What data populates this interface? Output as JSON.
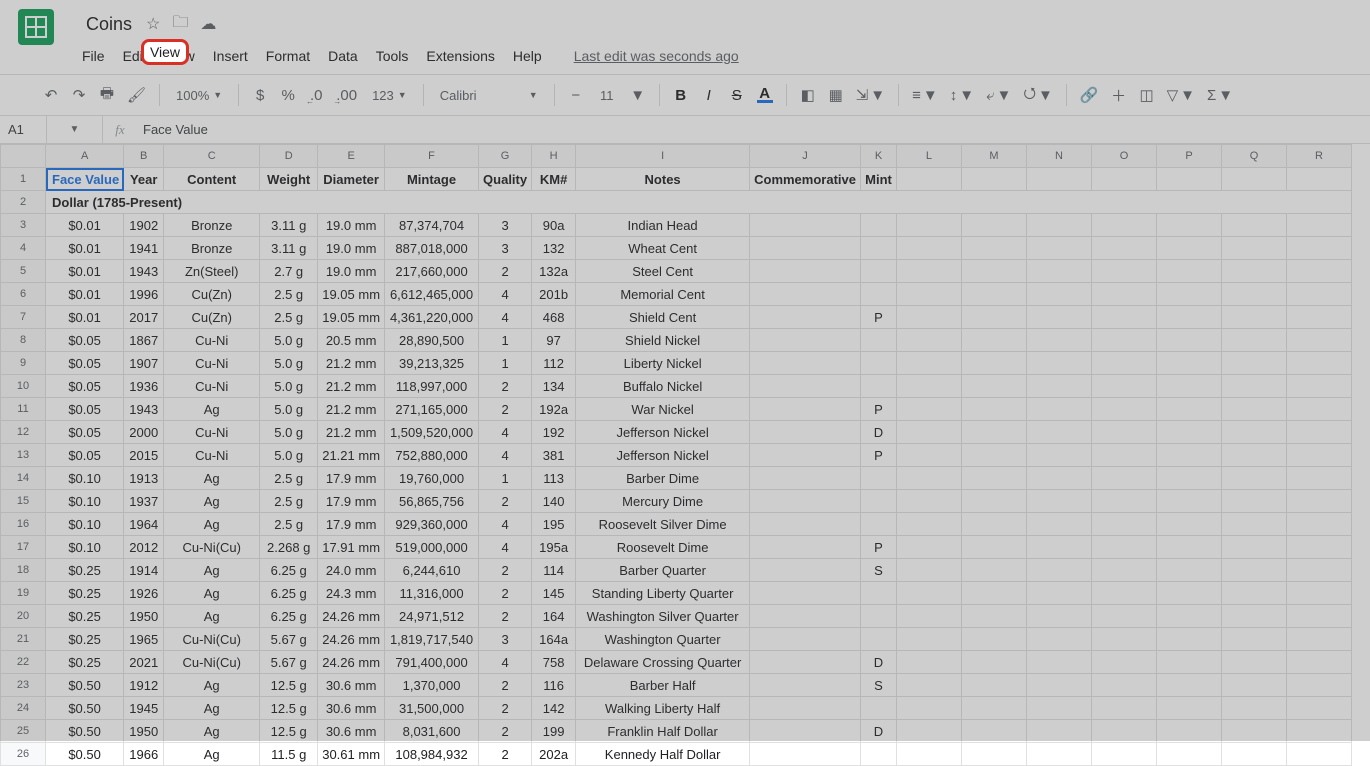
{
  "doc": {
    "title": "Coins"
  },
  "menubar": {
    "file": "File",
    "edit": "Edit",
    "view": "View",
    "insert": "Insert",
    "format": "Format",
    "data": "Data",
    "tools": "Tools",
    "extensions": "Extensions",
    "help": "Help",
    "last_edit": "Last edit was seconds ago"
  },
  "toolbar": {
    "zoom": "100%",
    "font": "Calibri",
    "fontsize": "11",
    "currency": "$",
    "percent": "%",
    "decr": ".0",
    "incr": ".00",
    "numfmt": "123",
    "bold": "B",
    "italic": "I",
    "strike": "S",
    "textA": "A"
  },
  "namebox": {
    "ref": "A1",
    "fx": "fx",
    "formula": "Face Value"
  },
  "col_letters": [
    "A",
    "B",
    "C",
    "D",
    "E",
    "F",
    "G",
    "H",
    "I",
    "J",
    "K",
    "L",
    "M",
    "N",
    "O",
    "P",
    "Q",
    "R"
  ],
  "headers": [
    "Face Value",
    "Year",
    "Content",
    "Weight",
    "Diameter",
    "Mintage",
    "Quality",
    "KM#",
    "Notes",
    "Commemorative",
    "Mint"
  ],
  "section": "Dollar (1785-Present)",
  "rows": [
    {
      "fv": "$0.01",
      "yr": "1902",
      "ct": "Bronze",
      "wt": "3.11 g",
      "dm": "19.0 mm",
      "mt": "87,374,704",
      "q": "3",
      "km": "90a",
      "nt": "Indian Head",
      "cm": "",
      "mn": ""
    },
    {
      "fv": "$0.01",
      "yr": "1941",
      "ct": "Bronze",
      "wt": "3.11 g",
      "dm": "19.0 mm",
      "mt": "887,018,000",
      "q": "3",
      "km": "132",
      "nt": "Wheat Cent",
      "cm": "",
      "mn": ""
    },
    {
      "fv": "$0.01",
      "yr": "1943",
      "ct": "Zn(Steel)",
      "wt": "2.7 g",
      "dm": "19.0 mm",
      "mt": "217,660,000",
      "q": "2",
      "km": "132a",
      "nt": "Steel Cent",
      "cm": "",
      "mn": ""
    },
    {
      "fv": "$0.01",
      "yr": "1996",
      "ct": "Cu(Zn)",
      "wt": "2.5 g",
      "dm": "19.05 mm",
      "mt": "6,612,465,000",
      "q": "4",
      "km": "201b",
      "nt": "Memorial Cent",
      "cm": "",
      "mn": ""
    },
    {
      "fv": "$0.01",
      "yr": "2017",
      "ct": "Cu(Zn)",
      "wt": "2.5 g",
      "dm": "19.05 mm",
      "mt": "4,361,220,000",
      "q": "4",
      "km": "468",
      "nt": "Shield Cent",
      "cm": "",
      "mn": "P"
    },
    {
      "fv": "$0.05",
      "yr": "1867",
      "ct": "Cu-Ni",
      "wt": "5.0 g",
      "dm": "20.5 mm",
      "mt": "28,890,500",
      "q": "1",
      "km": "97",
      "nt": "Shield Nickel",
      "cm": "",
      "mn": ""
    },
    {
      "fv": "$0.05",
      "yr": "1907",
      "ct": "Cu-Ni",
      "wt": "5.0 g",
      "dm": "21.2 mm",
      "mt": "39,213,325",
      "q": "1",
      "km": "112",
      "nt": "Liberty Nickel",
      "cm": "",
      "mn": ""
    },
    {
      "fv": "$0.05",
      "yr": "1936",
      "ct": "Cu-Ni",
      "wt": "5.0 g",
      "dm": "21.2 mm",
      "mt": "118,997,000",
      "q": "2",
      "km": "134",
      "nt": "Buffalo Nickel",
      "cm": "",
      "mn": ""
    },
    {
      "fv": "$0.05",
      "yr": "1943",
      "ct": "Ag",
      "wt": "5.0 g",
      "dm": "21.2 mm",
      "mt": "271,165,000",
      "q": "2",
      "km": "192a",
      "nt": "War Nickel",
      "cm": "",
      "mn": "P"
    },
    {
      "fv": "$0.05",
      "yr": "2000",
      "ct": "Cu-Ni",
      "wt": "5.0 g",
      "dm": "21.2 mm",
      "mt": "1,509,520,000",
      "q": "4",
      "km": "192",
      "nt": "Jefferson Nickel",
      "cm": "",
      "mn": "D"
    },
    {
      "fv": "$0.05",
      "yr": "2015",
      "ct": "Cu-Ni",
      "wt": "5.0 g",
      "dm": "21.21 mm",
      "mt": "752,880,000",
      "q": "4",
      "km": "381",
      "nt": "Jefferson Nickel",
      "cm": "",
      "mn": "P"
    },
    {
      "fv": "$0.10",
      "yr": "1913",
      "ct": "Ag",
      "wt": "2.5 g",
      "dm": "17.9 mm",
      "mt": "19,760,000",
      "q": "1",
      "km": "113",
      "nt": "Barber Dime",
      "cm": "",
      "mn": ""
    },
    {
      "fv": "$0.10",
      "yr": "1937",
      "ct": "Ag",
      "wt": "2.5 g",
      "dm": "17.9 mm",
      "mt": "56,865,756",
      "q": "2",
      "km": "140",
      "nt": "Mercury Dime",
      "cm": "",
      "mn": ""
    },
    {
      "fv": "$0.10",
      "yr": "1964",
      "ct": "Ag",
      "wt": "2.5 g",
      "dm": "17.9 mm",
      "mt": "929,360,000",
      "q": "4",
      "km": "195",
      "nt": "Roosevelt Silver Dime",
      "cm": "",
      "mn": ""
    },
    {
      "fv": "$0.10",
      "yr": "2012",
      "ct": "Cu-Ni(Cu)",
      "wt": "2.268 g",
      "dm": "17.91 mm",
      "mt": "519,000,000",
      "q": "4",
      "km": "195a",
      "nt": "Roosevelt Dime",
      "cm": "",
      "mn": "P"
    },
    {
      "fv": "$0.25",
      "yr": "1914",
      "ct": "Ag",
      "wt": "6.25 g",
      "dm": "24.0 mm",
      "mt": "6,244,610",
      "q": "2",
      "km": "114",
      "nt": "Barber Quarter",
      "cm": "",
      "mn": "S"
    },
    {
      "fv": "$0.25",
      "yr": "1926",
      "ct": "Ag",
      "wt": "6.25 g",
      "dm": "24.3 mm",
      "mt": "11,316,000",
      "q": "2",
      "km": "145",
      "nt": "Standing Liberty Quarter",
      "cm": "",
      "mn": ""
    },
    {
      "fv": "$0.25",
      "yr": "1950",
      "ct": "Ag",
      "wt": "6.25 g",
      "dm": "24.26 mm",
      "mt": "24,971,512",
      "q": "2",
      "km": "164",
      "nt": "Washington Silver Quarter",
      "cm": "",
      "mn": ""
    },
    {
      "fv": "$0.25",
      "yr": "1965",
      "ct": "Cu-Ni(Cu)",
      "wt": "5.67 g",
      "dm": "24.26 mm",
      "mt": "1,819,717,540",
      "q": "3",
      "km": "164a",
      "nt": "Washington Quarter",
      "cm": "",
      "mn": ""
    },
    {
      "fv": "$0.25",
      "yr": "2021",
      "ct": "Cu-Ni(Cu)",
      "wt": "5.67 g",
      "dm": "24.26 mm",
      "mt": "791,400,000",
      "q": "4",
      "km": "758",
      "nt": "Delaware Crossing Quarter",
      "cm": "",
      "mn": "D"
    },
    {
      "fv": "$0.50",
      "yr": "1912",
      "ct": "Ag",
      "wt": "12.5 g",
      "dm": "30.6 mm",
      "mt": "1,370,000",
      "q": "2",
      "km": "116",
      "nt": "Barber Half",
      "cm": "",
      "mn": "S"
    },
    {
      "fv": "$0.50",
      "yr": "1945",
      "ct": "Ag",
      "wt": "12.5 g",
      "dm": "30.6 mm",
      "mt": "31,500,000",
      "q": "2",
      "km": "142",
      "nt": "Walking Liberty Half",
      "cm": "",
      "mn": ""
    },
    {
      "fv": "$0.50",
      "yr": "1950",
      "ct": "Ag",
      "wt": "12.5 g",
      "dm": "30.6 mm",
      "mt": "8,031,600",
      "q": "2",
      "km": "199",
      "nt": "Franklin Half Dollar",
      "cm": "",
      "mn": "D"
    },
    {
      "fv": "$0.50",
      "yr": "1966",
      "ct": "Ag",
      "wt": "11.5 g",
      "dm": "30.61 mm",
      "mt": "108,984,932",
      "q": "2",
      "km": "202a",
      "nt": "Kennedy Half Dollar",
      "cm": "",
      "mn": ""
    }
  ]
}
